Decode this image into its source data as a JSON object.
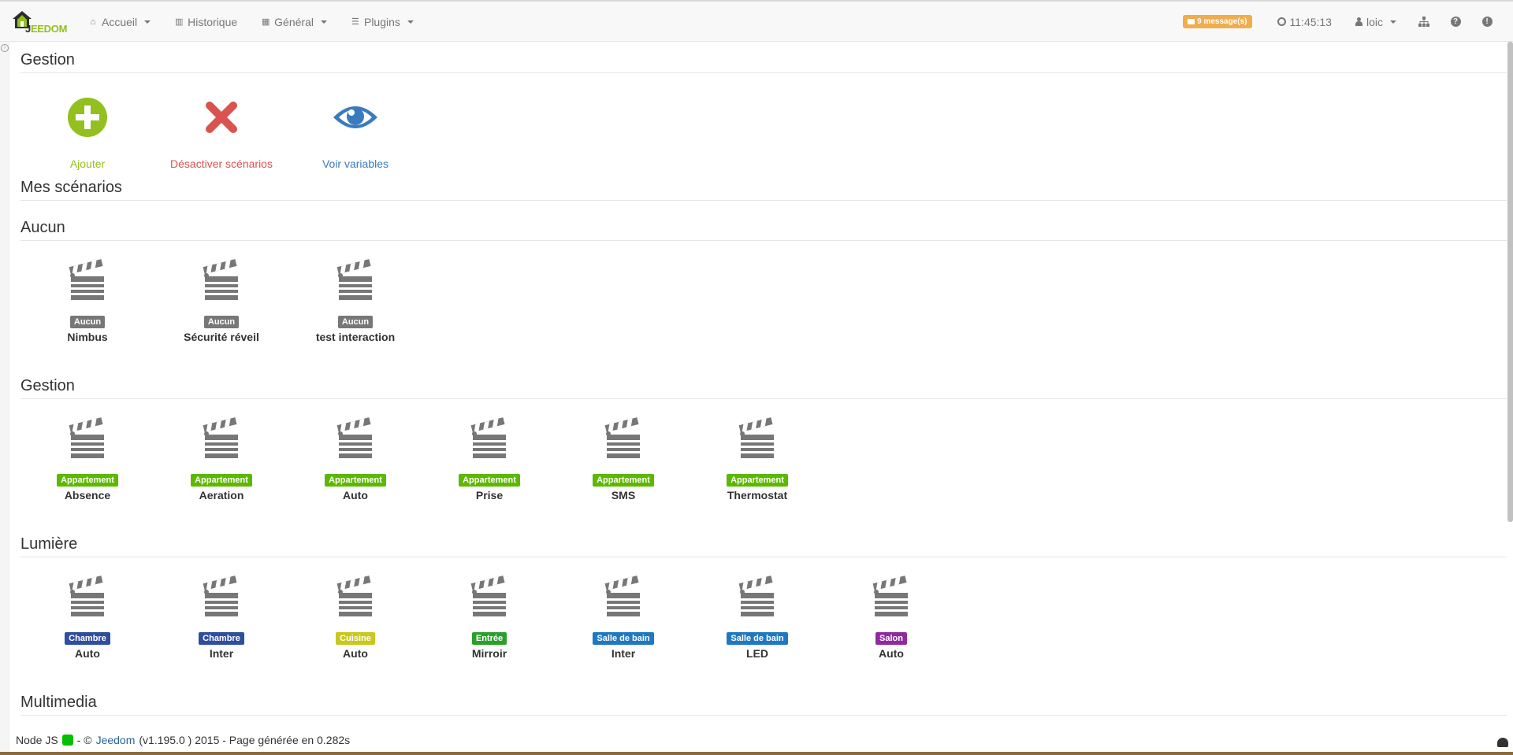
{
  "navbar": {
    "brand_letter": "J",
    "brand_rest": "EEDOM",
    "menu": [
      {
        "label": "Accueil",
        "icon": "home-icon"
      },
      {
        "label": "Historique",
        "icon": "bar-chart-icon"
      },
      {
        "label": "Général",
        "icon": "grid-icon"
      },
      {
        "label": "Plugins",
        "icon": "list-icon"
      }
    ],
    "messages": "9 message(s)",
    "time": "11:45:13",
    "user": "loic"
  },
  "gestion": {
    "title": "Gestion",
    "actions": [
      {
        "label": "Ajouter",
        "color": "#93c01f"
      },
      {
        "label": "Désactiver scénarios",
        "color": "#d9534f"
      },
      {
        "label": "Voir variables",
        "color": "#3a7bbf"
      }
    ]
  },
  "mes_scenarios_title": "Mes scénarios",
  "groups": [
    {
      "title": "Aucun",
      "scenarios": [
        {
          "badge": "Aucun",
          "badge_color": "#777777",
          "name": "Nimbus"
        },
        {
          "badge": "Aucun",
          "badge_color": "#777777",
          "name": "Sécurité réveil"
        },
        {
          "badge": "Aucun",
          "badge_color": "#777777",
          "name": "test interaction"
        }
      ]
    },
    {
      "title": "Gestion",
      "scenarios": [
        {
          "badge": "Appartement",
          "badge_color": "#5cb800",
          "name": "Absence"
        },
        {
          "badge": "Appartement",
          "badge_color": "#5cb800",
          "name": "Aeration"
        },
        {
          "badge": "Appartement",
          "badge_color": "#5cb800",
          "name": "Auto"
        },
        {
          "badge": "Appartement",
          "badge_color": "#5cb800",
          "name": "Prise"
        },
        {
          "badge": "Appartement",
          "badge_color": "#5cb800",
          "name": "SMS"
        },
        {
          "badge": "Appartement",
          "badge_color": "#5cb800",
          "name": "Thermostat"
        }
      ]
    },
    {
      "title": "Lumière",
      "scenarios": [
        {
          "badge": "Chambre",
          "badge_color": "#2f4f9e",
          "name": "Auto"
        },
        {
          "badge": "Chambre",
          "badge_color": "#2f4f9e",
          "name": "Inter"
        },
        {
          "badge": "Cuisine",
          "badge_color": "#c8c81e",
          "name": "Auto"
        },
        {
          "badge": "Entrée",
          "badge_color": "#2aa02a",
          "name": "Mirroir"
        },
        {
          "badge": "Salle de bain",
          "badge_color": "#1f78c1",
          "name": "Inter"
        },
        {
          "badge": "Salle de bain",
          "badge_color": "#1f78c1",
          "name": "LED"
        },
        {
          "badge": "Salon",
          "badge_color": "#8e2a9e",
          "name": "Auto"
        }
      ]
    },
    {
      "title": "Multimedia",
      "scenarios": []
    }
  ],
  "footer": {
    "node_label": "Node JS",
    "dash_copy": "- ©",
    "link": "Jeedom",
    "version": "(v1.195.0 ) 2015 - Page générée en 0.282s"
  }
}
